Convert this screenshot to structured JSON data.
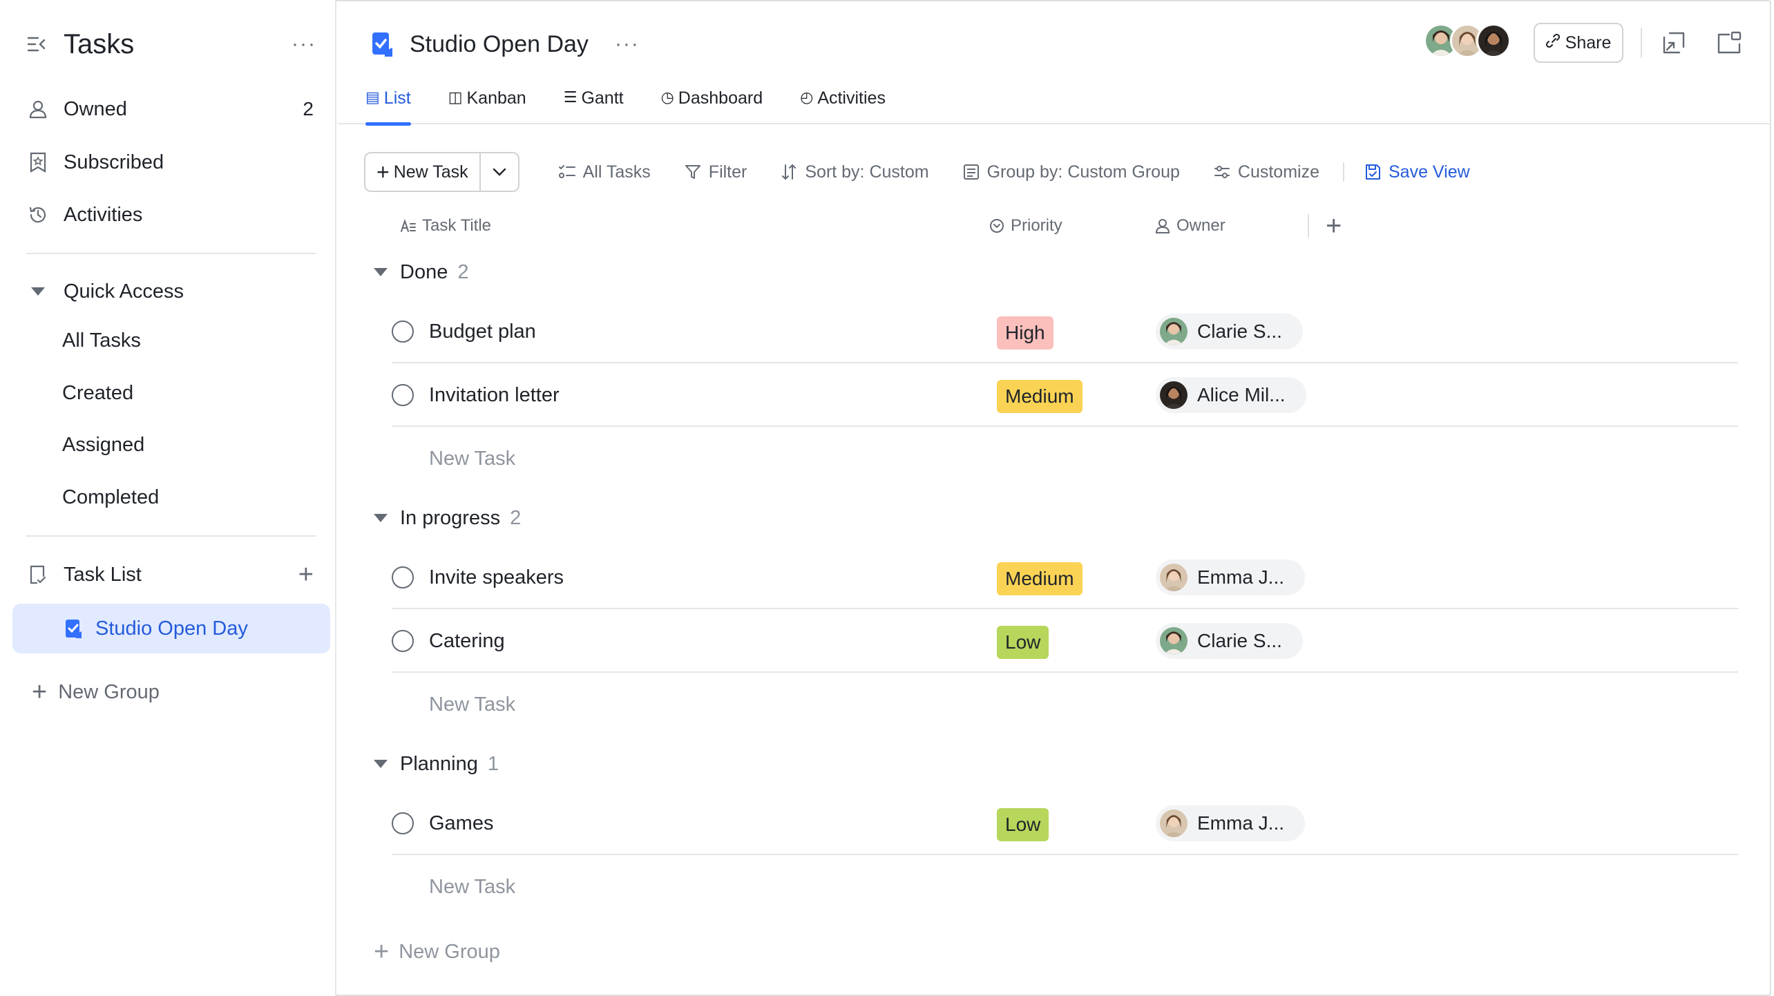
{
  "sidebar": {
    "title": "Tasks",
    "more": "···",
    "items": [
      {
        "label": "Owned",
        "count": "2"
      },
      {
        "label": "Subscribed"
      },
      {
        "label": "Activities"
      }
    ],
    "quick_access": {
      "label": "Quick Access",
      "items": [
        "All Tasks",
        "Created",
        "Assigned",
        "Completed"
      ]
    },
    "task_list": {
      "label": "Task List",
      "active_item": "Studio Open Day"
    },
    "new_group": "New Group"
  },
  "header": {
    "title": "Studio Open Day",
    "more": "···",
    "share_label": "Share",
    "tabs": [
      {
        "label": "List",
        "icon": "list-icon",
        "active": true
      },
      {
        "label": "Kanban",
        "icon": "kanban-icon"
      },
      {
        "label": "Gantt",
        "icon": "gantt-icon"
      },
      {
        "label": "Dashboard",
        "icon": "dashboard-icon"
      },
      {
        "label": "Activities",
        "icon": "activities-icon"
      }
    ]
  },
  "toolbar": {
    "new_task": "New Task",
    "all_tasks": "All Tasks",
    "filter": "Filter",
    "sort": "Sort by: Custom",
    "group": "Group by: Custom Group",
    "customize": "Customize",
    "save_view": "Save View"
  },
  "table": {
    "columns": {
      "title": "Task Title",
      "priority": "Priority",
      "owner": "Owner"
    },
    "new_task_placeholder": "New Task",
    "groups": [
      {
        "name": "Done",
        "count": "2",
        "tasks": [
          {
            "title": "Budget plan",
            "priority": "High",
            "owner": "Clarie S..."
          },
          {
            "title": "Invitation letter",
            "priority": "Medium",
            "owner": "Alice Mil..."
          }
        ]
      },
      {
        "name": "In progress",
        "count": "2",
        "tasks": [
          {
            "title": "Invite speakers",
            "priority": "Medium",
            "owner": "Emma J..."
          },
          {
            "title": "Catering",
            "priority": "Low",
            "owner": "Clarie S..."
          }
        ]
      },
      {
        "name": "Planning",
        "count": "1",
        "tasks": [
          {
            "title": "Games",
            "priority": "Low",
            "owner": "Emma J..."
          }
        ]
      }
    ],
    "new_group": "New Group"
  },
  "colors": {
    "accent": "#3370ff",
    "active_bg": "#e1eaff",
    "priority_high": "#fbbfbc",
    "priority_medium": "#fad355",
    "priority_low": "#b7d65c"
  }
}
